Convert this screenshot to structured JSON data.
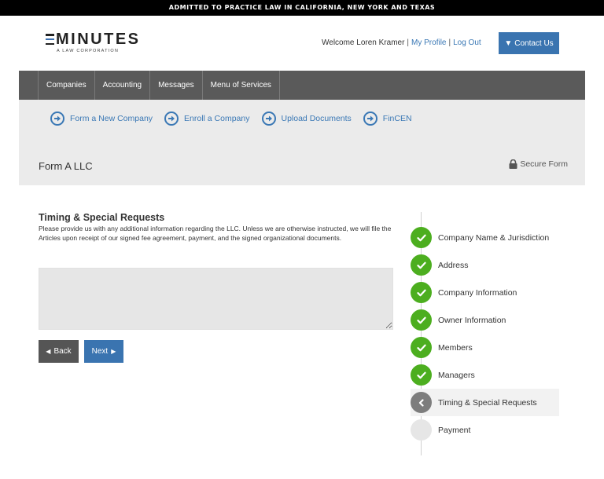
{
  "banner": "ADMITTED TO PRACTICE LAW IN CALIFORNIA, NEW YORK AND TEXAS",
  "logo": {
    "name": "MINUTES",
    "tagline": "A LAW CORPORATION"
  },
  "header": {
    "welcome": "Welcome Loren Kramer",
    "separator": "|",
    "my_profile": "My Profile",
    "log_out": "Log Out",
    "contact_icon": "▼",
    "contact_label": "Contact Us"
  },
  "nav": {
    "items": [
      "Companies",
      "Accounting",
      "Messages",
      "Menu of Services"
    ]
  },
  "quick_links": [
    {
      "label": "Form a New Company",
      "icon": "arrow-right-circle-icon"
    },
    {
      "label": "Enroll a Company",
      "icon": "arrow-right-circle-icon"
    },
    {
      "label": "Upload Documents",
      "icon": "arrow-right-circle-icon"
    },
    {
      "label": "FinCEN",
      "icon": "arrow-right-circle-icon"
    }
  ],
  "page": {
    "title": "Form A LLC",
    "secure_label": "Secure Form"
  },
  "section": {
    "title": "Timing & Special Requests",
    "description": "Please provide us with any additional information regarding the LLC. Unless we are otherwise instructed, we will file the Articles upon receipt of our signed fee agreement, payment, and the signed organizational documents.",
    "textarea_value": "",
    "textarea_placeholder": ""
  },
  "buttons": {
    "back_icon": "◀",
    "back": "Back",
    "next": "Next",
    "next_icon": "▶"
  },
  "steps": [
    {
      "label": "Company Name & Jurisdiction",
      "status": "done"
    },
    {
      "label": "Address",
      "status": "done"
    },
    {
      "label": "Company Information",
      "status": "done"
    },
    {
      "label": "Owner Information",
      "status": "done"
    },
    {
      "label": "Members",
      "status": "done"
    },
    {
      "label": "Managers",
      "status": "done"
    },
    {
      "label": "Timing & Special Requests",
      "status": "current"
    },
    {
      "label": "Payment",
      "status": "pending"
    }
  ],
  "colors": {
    "brand_blue": "#3a74b0",
    "nav_gray": "#5a5a5a",
    "done_green": "#4cae1f",
    "current_gray": "#7d7d7d"
  }
}
